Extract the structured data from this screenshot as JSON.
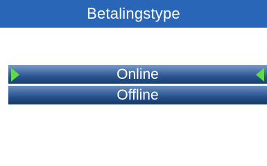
{
  "header": {
    "title": "Betalingstype"
  },
  "menu": {
    "items": [
      {
        "label": "Online",
        "selected": true
      },
      {
        "label": "Offline",
        "selected": false
      }
    ]
  },
  "colors": {
    "title_bar": "#2a66b7",
    "item_dark": "#163863",
    "item_light": "#6e8fbd",
    "selection_arrow": "#5fda4a",
    "background": "#ffffff"
  },
  "icons": {
    "selection_left": "triangle-right-icon",
    "selection_right": "triangle-left-icon"
  }
}
